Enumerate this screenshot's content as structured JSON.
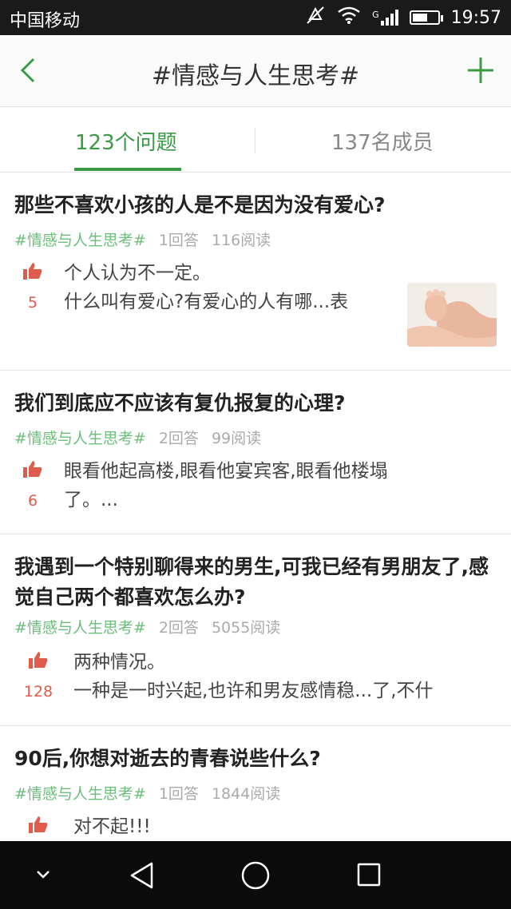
{
  "status": {
    "carrier": "中国移动",
    "time": "19:57",
    "network_badge": "G",
    "icons": [
      "mute-icon",
      "wifi-icon",
      "signal-icon",
      "battery-icon"
    ]
  },
  "nav": {
    "title": "#情感与人生思考#",
    "back_icon": "chevron-left-icon",
    "add_icon": "plus-icon"
  },
  "tabs": [
    {
      "label": "123个问题",
      "active": true
    },
    {
      "label": "137名成员",
      "active": false
    }
  ],
  "accent_color": "#3a9a46",
  "like_color": "#e05b4c",
  "questions": [
    {
      "title": "那些不喜欢小孩的人是不是因为没有爱心?",
      "topic": "#情感与人生思考#",
      "answers": "1回答",
      "reads": "116阅读",
      "likes": "5",
      "answer_lines": [
        "个人认为不一定。",
        "什么叫有爱心?有爱心的人有哪...表"
      ],
      "has_image": true
    },
    {
      "title": "我们到底应不应该有复仇报复的心理?",
      "topic": "#情感与人生思考#",
      "answers": "2回答",
      "reads": "99阅读",
      "likes": "6",
      "answer_lines": [
        "眼看他起高楼,眼看他宴宾客,眼看他楼塌",
        "了。..."
      ],
      "has_image": false
    },
    {
      "title": "我遇到一个特别聊得来的男生,可我已经有男朋友了,感觉自己两个都喜欢怎么办?",
      "topic": "#情感与人生思考#",
      "answers": "2回答",
      "reads": "5055阅读",
      "likes": "128",
      "answer_lines": [
        "两种情况。",
        "一种是一时兴起,也许和男友感情稳...了,不什"
      ],
      "has_image": false
    },
    {
      "title": "90后,你想对逝去的青春说些什么?",
      "topic": "#情感与人生思考#",
      "answers": "1回答",
      "reads": "1844阅读",
      "likes": "",
      "answer_lines": [
        "对不起!!!"
      ],
      "has_image": false
    }
  ],
  "system_nav": [
    "down-chevron-icon",
    "back-triangle-icon",
    "home-circle-icon",
    "recents-square-icon"
  ]
}
